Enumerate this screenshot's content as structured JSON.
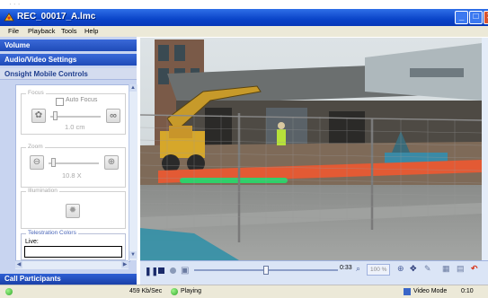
{
  "window": {
    "title": "REC_00017_A.lmc"
  },
  "menu": [
    "File",
    "Playback",
    "Tools",
    "Help"
  ],
  "sidebar": {
    "sections": [
      "Volume",
      "Audio/Video Settings",
      "Onsight Mobile Controls"
    ],
    "focus": {
      "label": "Focus",
      "auto_focus_label": "Auto Focus",
      "auto_focus_checked": false,
      "value": "1.0 cm"
    },
    "zoom": {
      "label": "Zoom",
      "value": "10.8 X"
    },
    "illumination": {
      "label": "Illumination"
    },
    "telestration": {
      "label": "Telestration Colors",
      "live_label": "Live:"
    },
    "footer": "Call Participants"
  },
  "transport": {
    "elapsed": "0:33",
    "zoom_percent": "100 %",
    "playback_progress": 0.5
  },
  "status": {
    "bitrate": "459 Kb/Sec",
    "state": "Playing",
    "mode": "Video Mode",
    "time": "0:10"
  },
  "icons": [
    "app-icon",
    "minimize-icon",
    "maximize-icon",
    "close-icon",
    "flower-icon",
    "infinity-icon",
    "zoom-out-icon",
    "zoom-in-icon",
    "light-icon",
    "pause-icon",
    "stop-icon",
    "record-icon",
    "snapshot-icon",
    "zoom-magnifier-icon",
    "pan-icon",
    "pen-icon",
    "eraser-icon",
    "telestrate-icon",
    "status-led-icon",
    "video-mode-icon"
  ],
  "colors": {
    "title_bar": "#0a44c8",
    "section_header": "#1f4bb8",
    "status_green": "#2fa82a"
  }
}
